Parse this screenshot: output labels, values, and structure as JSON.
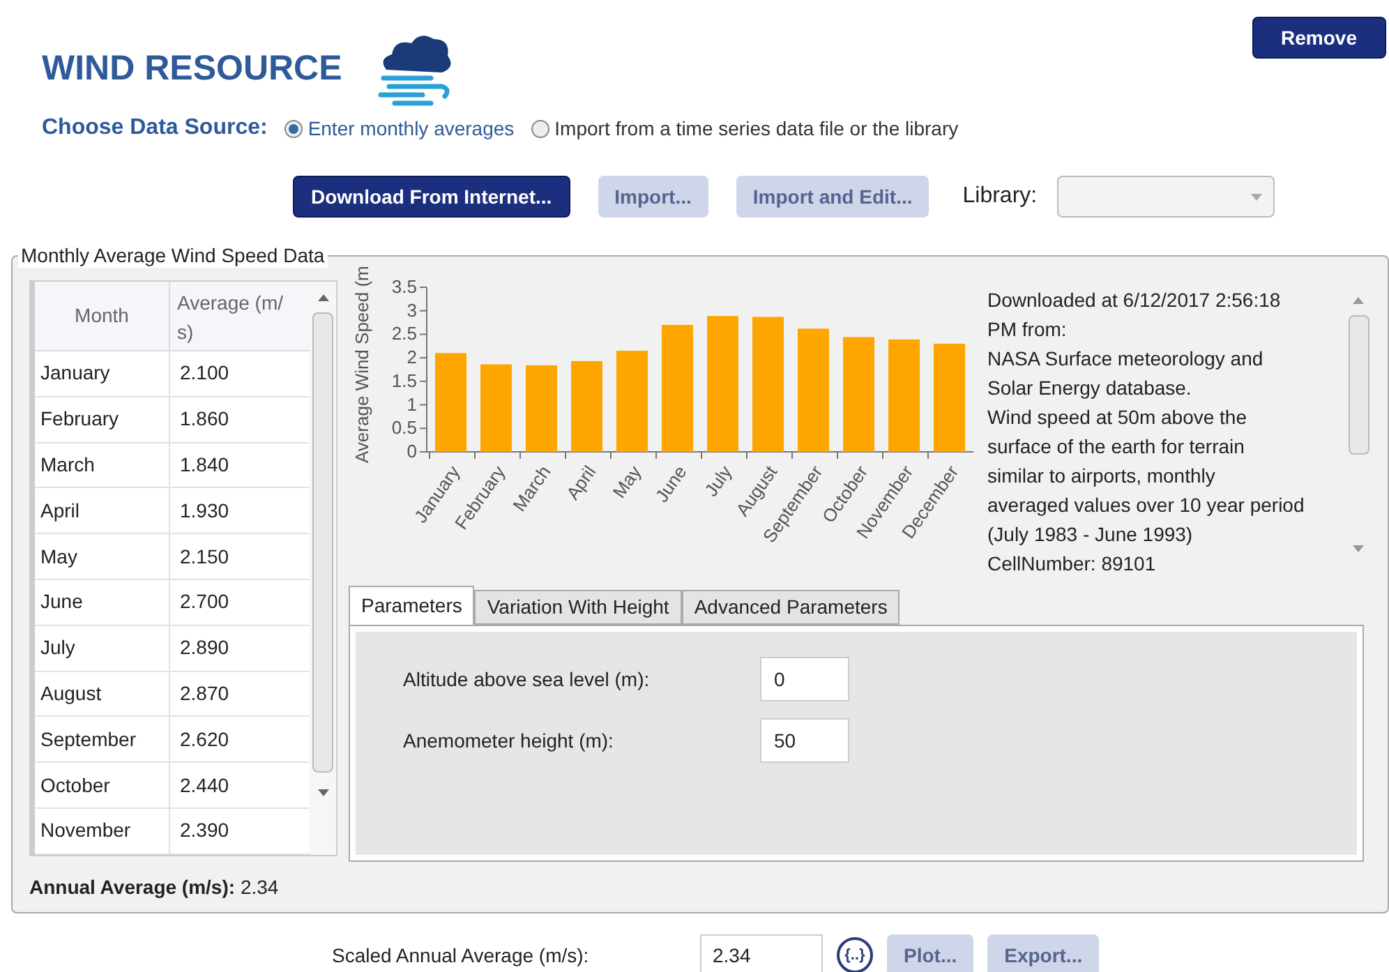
{
  "header": {
    "title": "WIND RESOURCE",
    "remove_button": "Remove"
  },
  "data_source": {
    "label": "Choose Data Source:",
    "options": [
      {
        "label": "Enter monthly averages",
        "selected": true
      },
      {
        "label": "Import from a time series data file or the library",
        "selected": false
      }
    ]
  },
  "toolbar": {
    "buttons": [
      {
        "label": "Download From Internet...",
        "disabled": false
      },
      {
        "label": "Import...",
        "disabled": true
      },
      {
        "label": "Import and Edit...",
        "disabled": true
      }
    ],
    "library_label": "Library:"
  },
  "group": {
    "title": "Monthly Average Wind Speed Data",
    "table": {
      "columns": [
        "Month",
        "Average (m/ s)"
      ],
      "rows": [
        [
          "January",
          "2.100"
        ],
        [
          "February",
          "1.860"
        ],
        [
          "March",
          "1.840"
        ],
        [
          "April",
          "1.930"
        ],
        [
          "May",
          "2.150"
        ],
        [
          "June",
          "2.700"
        ],
        [
          "July",
          "2.890"
        ],
        [
          "August",
          "2.870"
        ],
        [
          "September",
          "2.620"
        ],
        [
          "October",
          "2.440"
        ],
        [
          "November",
          "2.390"
        ]
      ]
    },
    "annual_average": {
      "label": "Annual Average (m/s):",
      "value": "2.34"
    },
    "chart_data": {
      "type": "bar",
      "ylabel": "Average Wind Speed (m",
      "categories": [
        "January",
        "February",
        "March",
        "April",
        "May",
        "June",
        "July",
        "August",
        "September",
        "October",
        "November",
        "December"
      ],
      "series": [
        {
          "color": "#ffa500",
          "values": [
            2.1,
            1.86,
            1.84,
            1.93,
            2.15,
            2.7,
            2.89,
            2.87,
            2.62,
            2.44,
            2.39,
            2.3
          ]
        }
      ],
      "ylim": [
        0,
        3.5
      ],
      "yticks": [
        0,
        0.5,
        1,
        1.5,
        2,
        2.5,
        3,
        3.5
      ]
    },
    "note_lines": [
      "Downloaded at 6/12/2017 2:56:18",
      "PM from:",
      "NASA Surface meteorology and",
      "Solar Energy database.",
      "Wind speed at 50m above the",
      "surface of the earth for terrain",
      "similar to airports, monthly",
      "averaged values over 10 year period",
      "(July 1983 - June 1993)",
      "CellNumber: 89101"
    ],
    "tabs": [
      {
        "label": "Parameters",
        "selected": true
      },
      {
        "label": "Variation With Height",
        "selected": false
      },
      {
        "label": "Advanced Parameters",
        "selected": false
      }
    ],
    "fields": [
      {
        "label": "Altitude above sea level (m):",
        "value": "0"
      },
      {
        "label": "Anemometer height (m):",
        "value": "50"
      }
    ]
  },
  "footer": {
    "label": "Scaled Annual Average (m/s):",
    "value": "2.34",
    "edit_button": "{..}",
    "buttons": [
      {
        "label": "Plot...",
        "disabled": true
      },
      {
        "label": "Export...",
        "disabled": true
      }
    ]
  }
}
